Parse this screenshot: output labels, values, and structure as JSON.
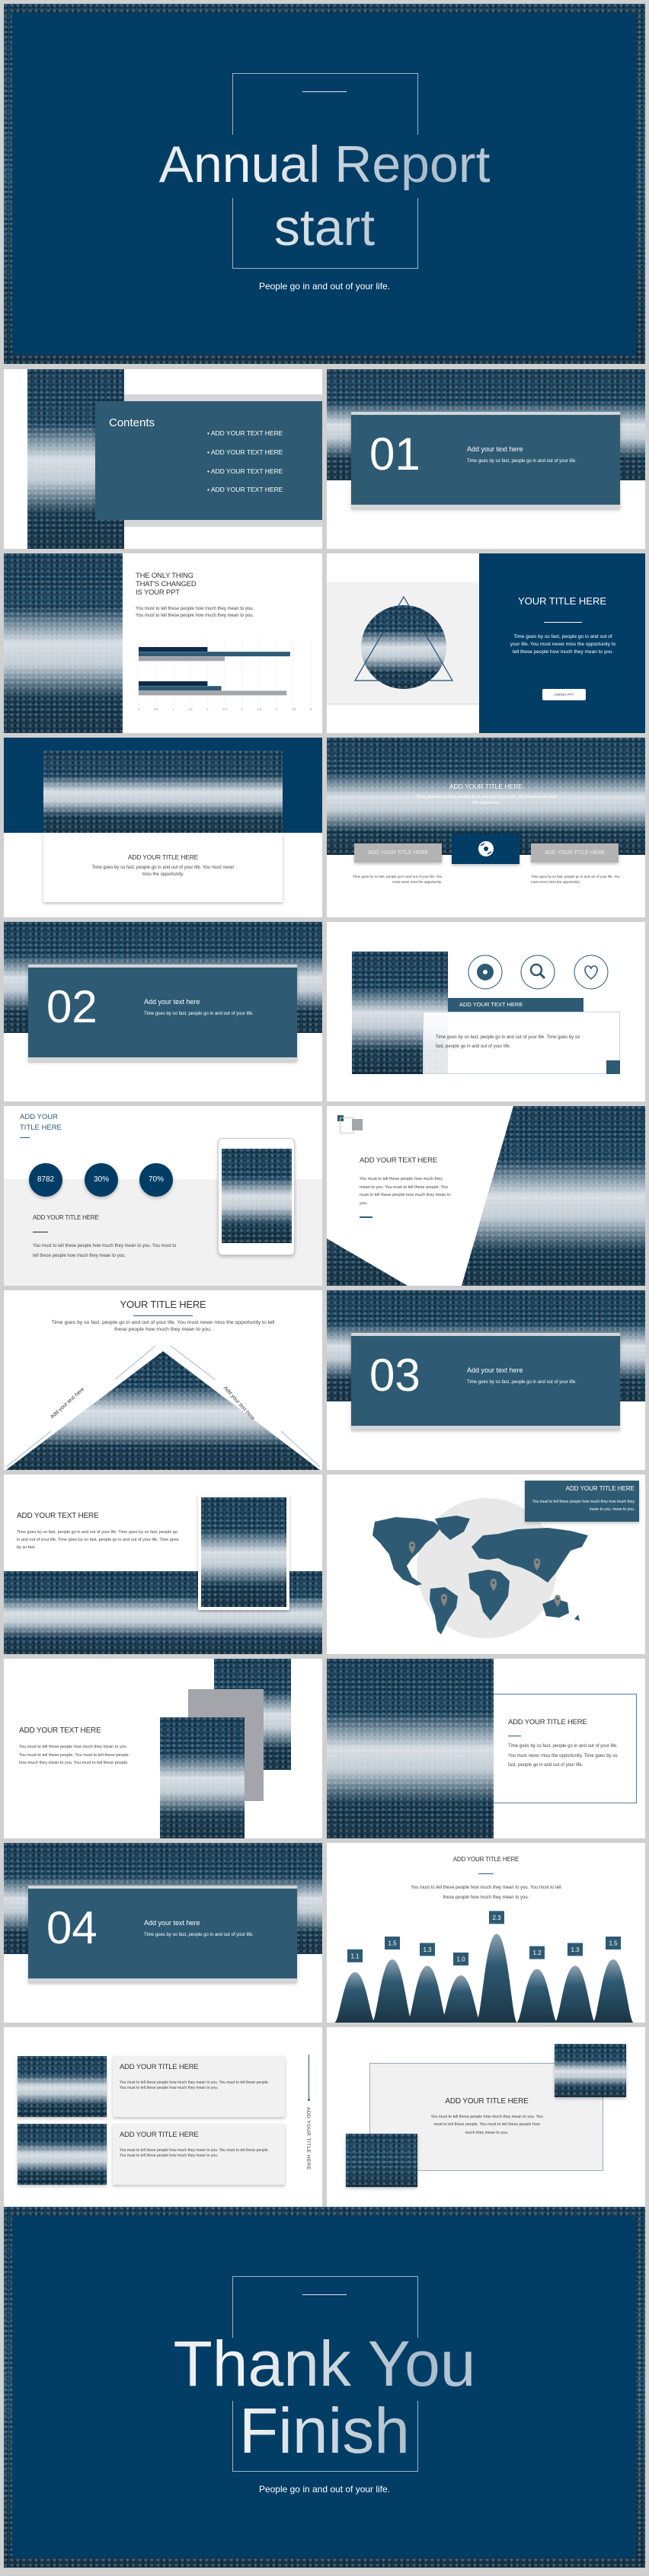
{
  "colors": {
    "navy": "#023d66",
    "steel": "#2e5b73",
    "gray": "#a3a5ab",
    "light": "#f0f0f0"
  },
  "cover": {
    "title_line1": "Annual Report",
    "title_line2": "start",
    "subtitle": "People go in and out of your life."
  },
  "contents": {
    "heading": "Contents",
    "items": [
      "ADD YOUR TEXT HERE",
      "ADD YOUR TEXT HERE",
      "ADD YOUR TEXT HERE",
      "ADD YOUR TEXT HERE"
    ]
  },
  "sections": [
    {
      "number": "01",
      "title": "Add your text here",
      "text": "Time goes by so fast, people go in and out of your life."
    },
    {
      "number": "02",
      "title": "Add your text here",
      "text": "Time goes by so fast, people go in and out of your life."
    },
    {
      "number": "03",
      "title": "Add your text here",
      "text": "Time goes by so fast, people go in and out of your life."
    },
    {
      "number": "04",
      "title": "Add your text here",
      "text": "Time goes by so fast, people go in and out of your life."
    }
  ],
  "slide_chart": {
    "title_lines": [
      "THE ONLY THING",
      "THAT'S CHANGED",
      "IS YOUR PPT"
    ],
    "text": "You must to tell these people how much they mean to you. You must to tell these people how much they mean to you.",
    "chart": {
      "type": "bar",
      "orientation": "horizontal",
      "xlim": [
        0,
        5
      ],
      "ticks": [
        "0",
        "0.5",
        "1",
        "1.5",
        "2",
        "2.5",
        "3",
        "3.5",
        "4",
        "4.5",
        "5"
      ],
      "series_colors": [
        "#0d2a4f",
        "#2e5b73",
        "#a3a5ab"
      ],
      "groups": [
        [
          2.0,
          4.4,
          2.5
        ],
        [
          2.0,
          2.4,
          4.3
        ]
      ]
    }
  },
  "slide_circle": {
    "title": "YOUR TITLE HERE",
    "text": "Time goes by so fast, people go in and out of your life. You must never miss the opportunity to tell these people how much they mean to you.",
    "button": "XIMING PPT"
  },
  "slide_card": {
    "title": "ADD YOUR TITLE HERE",
    "text": "Time goes by so fast, people go in and out of your life. You must never miss the opportunity."
  },
  "slide_banner": {
    "title": "ADD YOUR TITLE HERE",
    "text": "Time goes by so fast, people go in and out of your life. You must never miss the opportunity.",
    "left_label": "ADD YOUR TITLE HERE",
    "right_label": "ADD YOUR TITLE HERE",
    "left_caption": "Time goes by so fast, people go in and out of your life. You must never miss the opportunity.",
    "right_caption": "Time goes by so fast, people go in and out of your life. You must never miss the opportunity.",
    "icon": "disc-icon"
  },
  "slide_icons": {
    "icons": [
      "disc-icon",
      "search-icon",
      "heart-icon"
    ],
    "label": "ADD YOUR TEXT HERE",
    "text": "Time goes by so fast, people go in and out of your life. Time goes by so fast, people go in and out of your life."
  },
  "slide_stats": {
    "title_lines": [
      "ADD YOUR",
      "TITLE HERE"
    ],
    "stats": [
      "8782",
      "30%",
      "70%"
    ],
    "subtitle": "ADD YOUR TITLE HERE",
    "text": "You must to tell these people how much they mean to you. You must to tell these people how much they mean to you."
  },
  "slide_diagonal": {
    "title": "ADD YOUR TEXT HERE",
    "text": "You must to tell these people how much they mean to you. You must to tell these people. You must to tell these people how much they mean to you."
  },
  "slide_pyramid": {
    "title": "YOUR TITLE HERE",
    "text": "Time goes by so fast, people go in and out of your life. You must never miss the opportunity to tell these people how much they mean to you.",
    "left_label": "Add your text here",
    "right_label": "Add your text here"
  },
  "slide_framed": {
    "title": "ADD YOUR TEXT HERE",
    "text": "Time goes by so fast, people go in and out of your life. Time goes by so fast, people go in and out of your life. Time goes by so fast, people go in and out of your life. Time goes by so fast."
  },
  "slide_map": {
    "title": "ADD YOUR TITLE HERE",
    "text": "You must to tell these people how much they how much they mean to you. mean to you."
  },
  "slide_stack": {
    "title": "ADD YOUR TEXT HERE",
    "text": "You must to tell these people how much they mean to you. You must to tell these people. You must to tell these people how much they mean to you. You must to tell these people."
  },
  "slide_boxed": {
    "title": "ADD YOUR TITLE HERE",
    "text": "Time goes by so fast, people go in and out of your life. You must never miss the opportunity. Time goes by so fast, people go in and out of your life."
  },
  "slide_peaks": {
    "title": "ADD YOUR TITLE HERE",
    "text": "You must to tell these people how much they mean to you. You must to tell these people how much they mean to you.",
    "values": [
      1.1,
      1.5,
      1.3,
      1.0,
      2.3,
      1.2,
      1.3,
      1.5
    ],
    "labels": [
      "1.1",
      "1.5",
      "1.3",
      "1.0",
      "2.3",
      "1.2",
      "1.3",
      "1.5"
    ]
  },
  "slide_list": {
    "items": [
      {
        "title": "ADD YOUR TITLE HERE",
        "text": "You must to tell these people how much they mean to you. You must to tell these people. You must to tell these people how much they mean to you."
      },
      {
        "title": "ADD YOUR TITLE HERE",
        "text": "You must to tell these people how much they mean to you. You must to tell these people. You must to tell these people how much they mean to you."
      }
    ],
    "side_title": "ADD YOUR TITLE HERE"
  },
  "slide_gallery": {
    "title": "ADD YOUR TITLE HERE",
    "text": "You must to tell these people how much they mean to you. You must to tell these people. You must to tell these people how much they mean to you."
  },
  "closing": {
    "title_line1": "Thank You",
    "title_line2": "Finish",
    "subtitle": "People go in and out of your life."
  }
}
